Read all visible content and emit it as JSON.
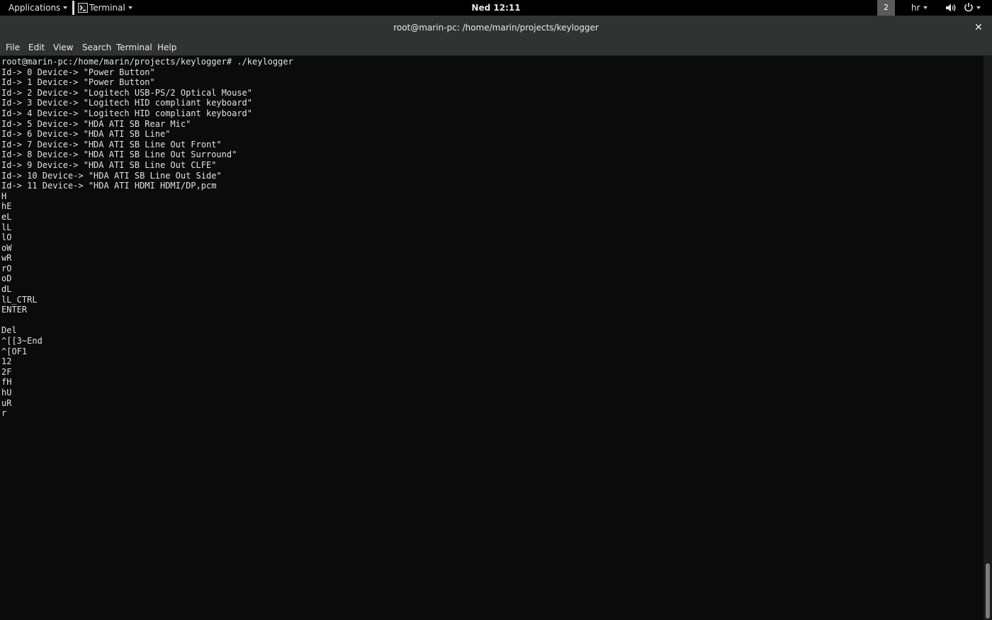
{
  "topbar": {
    "applications_label": "Applications",
    "task_label": "Terminal",
    "clock": "Ned 12:11",
    "workspace": "2",
    "language": "hr"
  },
  "window": {
    "title": "root@marin-pc: /home/marin/projects/keylogger",
    "close_glyph": "✕"
  },
  "menu": {
    "items": [
      "File",
      "Edit",
      "View",
      "Search",
      "Terminal",
      "Help"
    ]
  },
  "terminal": {
    "lines": [
      "root@marin-pc:/home/marin/projects/keylogger# ./keylogger",
      "Id-> 0 Device-> \"Power Button\"",
      "Id-> 1 Device-> \"Power Button\"",
      "Id-> 2 Device-> \"Logitech USB-PS/2 Optical Mouse\"",
      "Id-> 3 Device-> \"Logitech HID compliant keyboard\"",
      "Id-> 4 Device-> \"Logitech HID compliant keyboard\"",
      "Id-> 5 Device-> \"HDA ATI SB Rear Mic\"",
      "Id-> 6 Device-> \"HDA ATI SB Line\"",
      "Id-> 7 Device-> \"HDA ATI SB Line Out Front\"",
      "Id-> 8 Device-> \"HDA ATI SB Line Out Surround\"",
      "Id-> 9 Device-> \"HDA ATI SB Line Out CLFE\"",
      "Id-> 10 Device-> \"HDA ATI SB Line Out Side\"",
      "Id-> 11 Device-> \"HDA ATI HDMI HDMI/DP,pcm",
      "H",
      "hE",
      "eL",
      "lL",
      "lO",
      "oW",
      "wR",
      "rO",
      "oD",
      "dL",
      "lL_CTRL",
      "ENTER",
      "",
      "Del",
      "^[[3~End",
      "^[OF1",
      "12",
      "2F",
      "fH",
      "hU",
      "uR",
      "r"
    ]
  },
  "colors": {
    "topbar_bg": "#000000",
    "window_chrome": "#2f3433",
    "terminal_bg": "#0b0b0b",
    "terminal_fg": "#e2e2e2"
  },
  "icons": {
    "terminal": "terminal-icon",
    "volume": "volume-icon",
    "power": "power-icon",
    "close": "close-icon"
  }
}
